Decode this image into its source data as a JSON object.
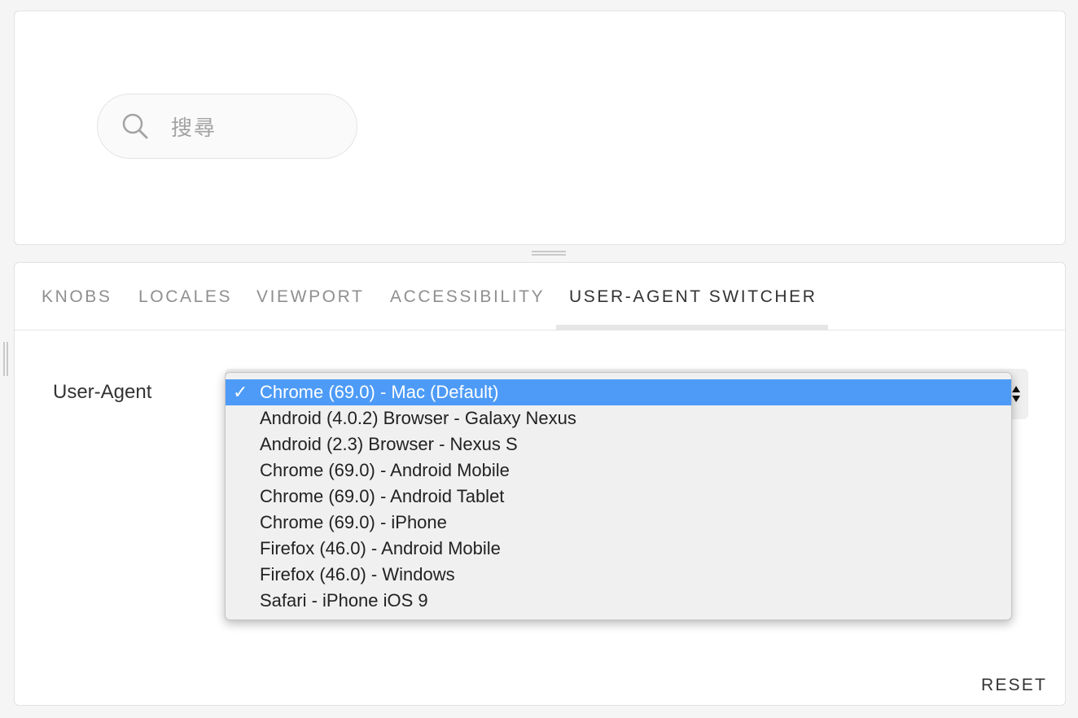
{
  "preview": {
    "search": {
      "icon": "search-icon",
      "placeholder": "搜尋"
    }
  },
  "addons": {
    "tabs": [
      {
        "label": "KNOBS",
        "active": false
      },
      {
        "label": "LOCALES",
        "active": false
      },
      {
        "label": "VIEWPORT",
        "active": false
      },
      {
        "label": "ACCESSIBILITY",
        "active": false
      },
      {
        "label": "USER-AGENT SWITCHER",
        "active": true
      }
    ],
    "user_agent": {
      "label": "User-Agent",
      "selected_mark": "✓",
      "options": [
        "Chrome (69.0) - Mac (Default)",
        "Android (4.0.2) Browser - Galaxy Nexus",
        "Android (2.3) Browser - Nexus S",
        "Chrome (69.0) - Android Mobile",
        "Chrome (69.0) - Android Tablet",
        "Chrome (69.0) - iPhone",
        "Firefox (46.0) - Android Mobile",
        "Firefox (46.0) - Windows",
        "Safari - iPhone iOS 9"
      ],
      "selected_index": 0
    },
    "reset_label": "RESET"
  },
  "colors": {
    "accent_selected": "#4d9bf7",
    "text_primary": "#333333",
    "text_inactive": "#8f8f8f"
  }
}
